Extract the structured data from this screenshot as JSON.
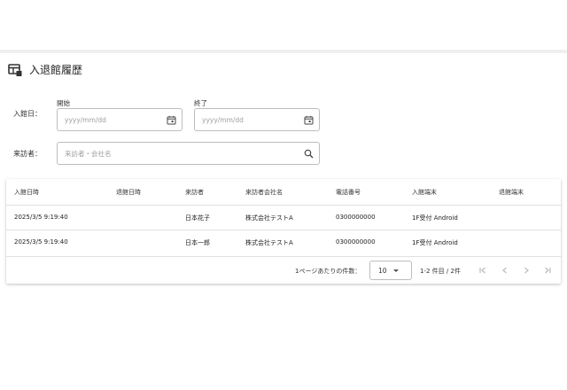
{
  "header": {
    "title": "入退館履歴",
    "icon": "table-icon"
  },
  "filters": {
    "entry_date_label": "入館日：",
    "start_label": "開始",
    "end_label": "終了",
    "start_placeholder": "yyyy/mm/dd",
    "end_placeholder": "yyyy/mm/dd",
    "visitor_label": "来訪者：",
    "visitor_placeholder": "来訪者・会社名"
  },
  "table": {
    "columns": [
      "入館日時",
      "退館日時",
      "来訪者",
      "来訪者会社名",
      "電話番号",
      "入館端末",
      "退館端末"
    ],
    "rows": [
      [
        "2025/3/5 9:19:40",
        "",
        "日本花子",
        "株式会社テストA",
        "0300000000",
        "1F受付 Android",
        ""
      ],
      [
        "2025/3/5 9:19:40",
        "",
        "日本一郎",
        "株式会社テストA",
        "0300000000",
        "1F受付 Android",
        ""
      ]
    ]
  },
  "pagination": {
    "per_page_label": "1ページあたりの件数：",
    "per_page_value": "10",
    "range_text": "1-2 件目 / 2件"
  },
  "colors": {
    "accent": "#333333",
    "border": "#bdbdbd",
    "placeholder": "#9e9e9e"
  }
}
